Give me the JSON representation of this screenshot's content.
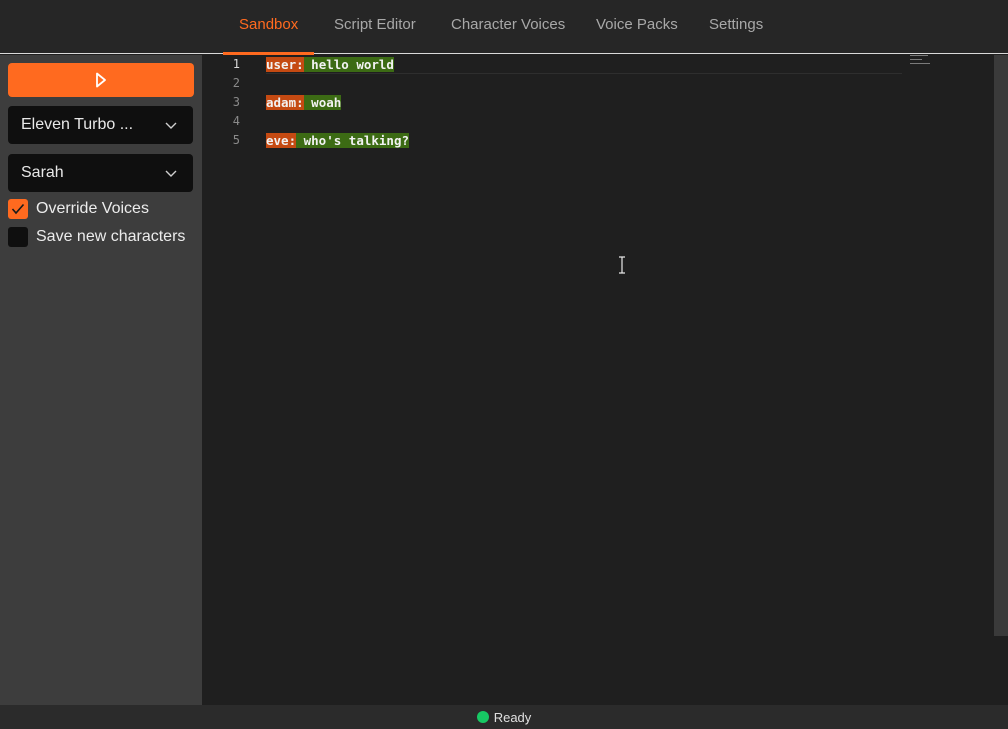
{
  "nav": {
    "tabs": [
      {
        "label": "Sandbox",
        "active": true
      },
      {
        "label": "Script Editor",
        "active": false
      },
      {
        "label": "Character Voices",
        "active": false
      },
      {
        "label": "Voice Packs",
        "active": false
      },
      {
        "label": "Settings",
        "active": false
      }
    ]
  },
  "sidebar": {
    "play_icon": "play-icon",
    "model_select": {
      "value": "Eleven Turbo ..."
    },
    "voice_select": {
      "value": "Sarah"
    },
    "override_voices": {
      "label": "Override Voices",
      "checked": true
    },
    "save_new_characters": {
      "label": "Save new characters",
      "checked": false
    }
  },
  "editor": {
    "line_numbers": [
      "1",
      "2",
      "3",
      "4",
      "5"
    ],
    "lines": [
      {
        "speaker": "user:",
        "text": " hello world"
      },
      {
        "speaker": "",
        "text": ""
      },
      {
        "speaker": "adam:",
        "text": " woah"
      },
      {
        "speaker": "",
        "text": ""
      },
      {
        "speaker": "eve:",
        "text": " who's talking?"
      }
    ]
  },
  "status": {
    "text": "Ready",
    "color": "#17c964"
  },
  "colors": {
    "accent": "#ff6a1f",
    "speaker_bg": "#c54a12",
    "text_bg": "#3c6b14"
  }
}
